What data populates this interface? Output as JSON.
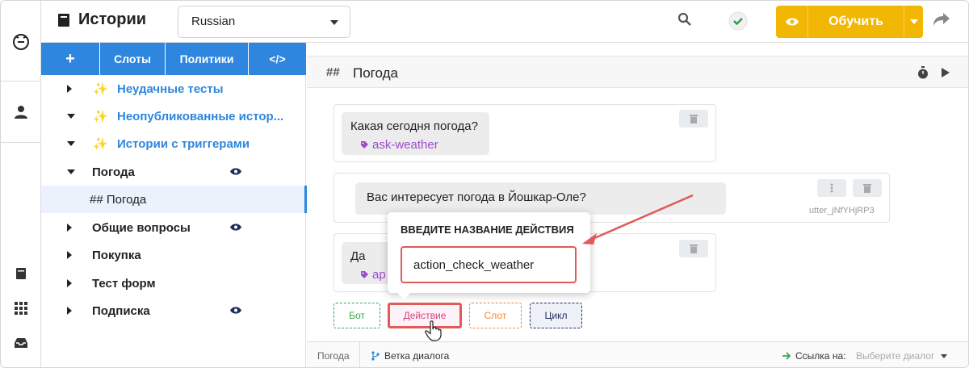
{
  "header": {
    "title": "Истории",
    "language": "Russian",
    "train_label": "Обучить"
  },
  "tabs": {
    "add": "+",
    "slots": "Слоты",
    "policies": "Политики",
    "code": "</>"
  },
  "tree": [
    {
      "label": "Неудачные тесты",
      "special": true,
      "expanded": false
    },
    {
      "label": "Неопубликованные истор...",
      "special": true,
      "expanded": true
    },
    {
      "label": "Истории с триггерами",
      "special": true,
      "expanded": true
    },
    {
      "label": "Погода",
      "special": false,
      "expanded": true,
      "eye": true
    },
    {
      "label": "## Погода",
      "selected": true
    },
    {
      "label": "Общие вопросы",
      "special": false,
      "expanded": false,
      "eye": true
    },
    {
      "label": "Покупка",
      "special": false,
      "expanded": false
    },
    {
      "label": "Тест форм",
      "special": false,
      "expanded": false
    },
    {
      "label": "Подписка",
      "special": false,
      "expanded": false,
      "eye": true
    }
  ],
  "story": {
    "hash": "##",
    "title": "Погода",
    "user_msg_1": "Какая сегодня погода?",
    "intent_1": "ask-weather",
    "bot_msg": "Вас интересует погода в Йошкар-Оле?",
    "utter_name": "utter_jNfYHjRP3",
    "user_msg_2": "Да",
    "intent_2": "ap"
  },
  "popover": {
    "heading": "ВВЕДИТЕ НАЗВАНИЕ ДЕЙСТВИЯ",
    "value": "action_check_weather"
  },
  "add_buttons": {
    "bot": "Бот",
    "action": "Действие",
    "slot": "Слот",
    "loop": "Цикл"
  },
  "footer": {
    "story_name": "Погода",
    "branch": "Ветка диалога",
    "link_label": "Ссылка на:",
    "link_placeholder": "Выберите диалог"
  },
  "colors": {
    "primary": "#2e86de",
    "train": "#f2b705",
    "intent": "#9b4dca",
    "highlight": "#e05a5a"
  }
}
